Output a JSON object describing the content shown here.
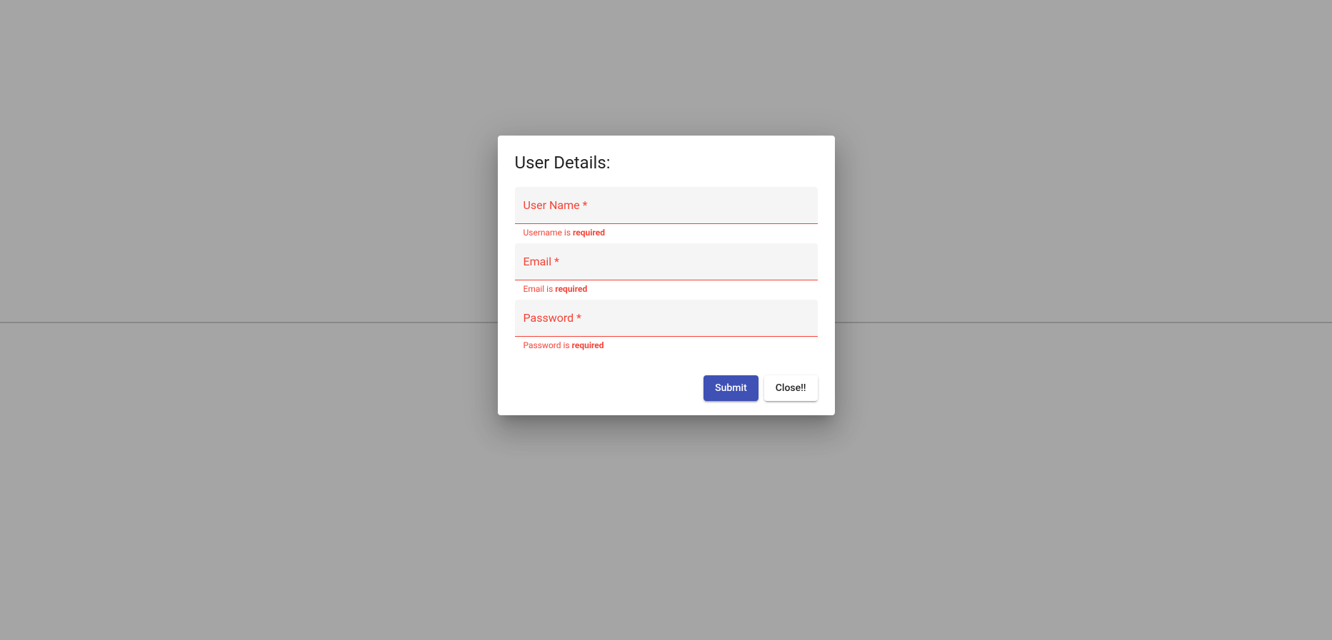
{
  "dialog": {
    "title": "User Details:",
    "fields": {
      "username": {
        "label": "User Name *",
        "value": "",
        "hint_prefix": "Username is ",
        "hint_strong": "required"
      },
      "email": {
        "label": "Email *",
        "value": "",
        "hint_prefix": "Email is ",
        "hint_strong": "required"
      },
      "password": {
        "label": "Password *",
        "value": "",
        "hint_prefix": "Password is ",
        "hint_strong": "required"
      }
    },
    "actions": {
      "submit": "Submit",
      "close": "Close!!"
    }
  },
  "colors": {
    "error": "#f44336",
    "primary": "#3f51b5",
    "surface": "#ffffff",
    "fieldBg": "#f5f5f5",
    "backdrop": "#a5a5a5"
  }
}
